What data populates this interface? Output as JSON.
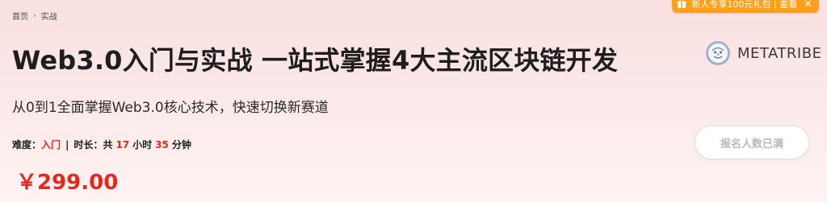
{
  "breadcrumb": {
    "home": "首页",
    "current": "实战"
  },
  "promo": {
    "text": "新人专享100元礼包 | 查看",
    "close": "✕"
  },
  "course": {
    "title": "Web3.0入门与实战 一站式掌握4大主流区块链开发",
    "subtitle": "从0到1全面掌握Web3.0核心技术，快速切换新赛道",
    "difficulty_label": "难度：",
    "difficulty_value": "入门",
    "divider": "|",
    "duration_label": "时长：",
    "duration_prefix": "共",
    "hours_value": "17",
    "hours_unit": "小时",
    "minutes_value": "35",
    "minutes_unit": "分钟",
    "price": "￥299.00",
    "signup_label": "报名人数已满"
  },
  "brand": {
    "name": "METATRIBE",
    "logo_icon": "metatribe-logo"
  },
  "colors": {
    "accent_red": "#e5271c",
    "promo_orange": "#ff9f1a"
  }
}
